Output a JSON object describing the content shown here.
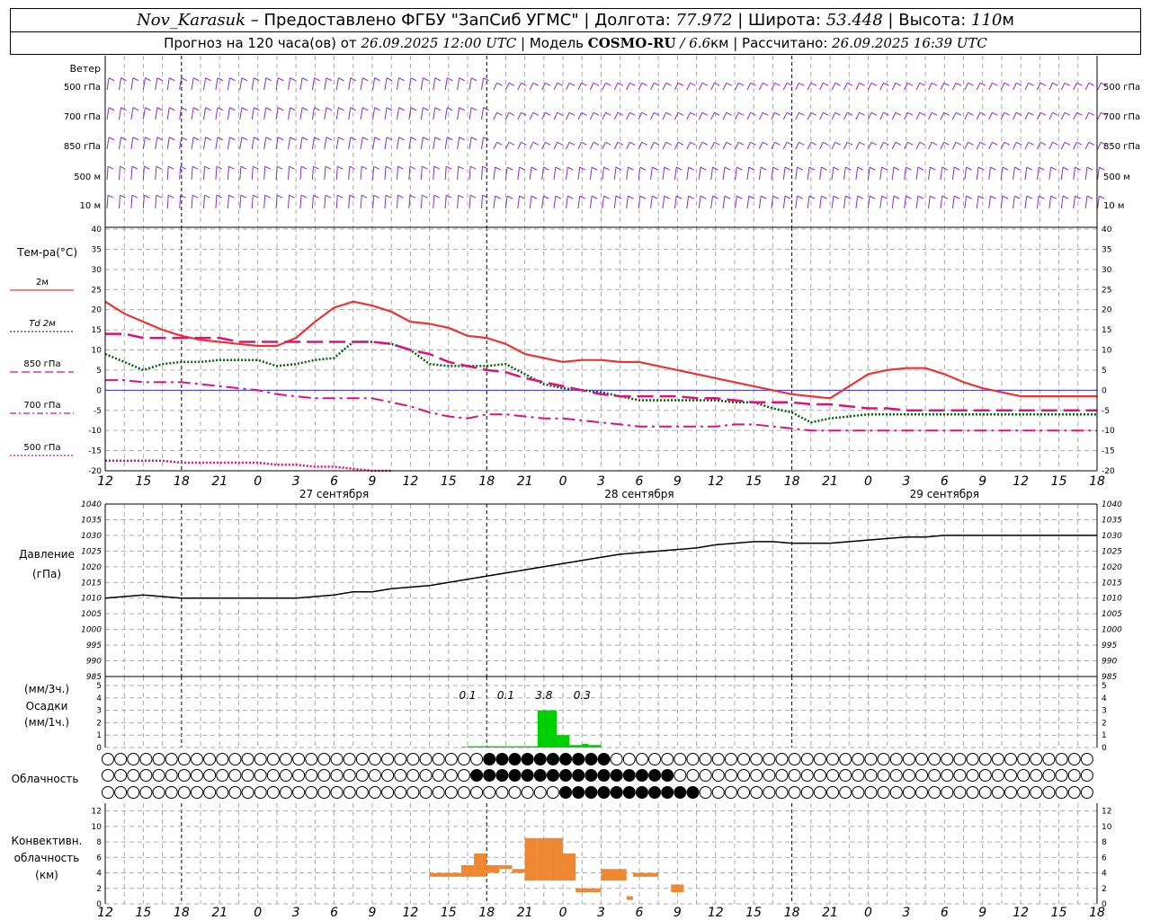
{
  "header": {
    "station": "Nov_Karasuk",
    "dash": " – ",
    "provider": "Предоставлено ФГБУ \"ЗапСиб УГМС\"",
    "sep": " | ",
    "lon_label": "Долгота: ",
    "lon_value": "77.972",
    "lat_label": "Широта: ",
    "lat_value": "53.448",
    "alt_label": "Высота: ",
    "alt_value": "110",
    "alt_unit": "м",
    "forecast_prefix": "Прогноз на 120 часа(ов) от ",
    "forecast_date": "26.09.2025 12:00 UTC",
    "model_label": " | Модель ",
    "model_name": "COSMO-RU",
    "model_res": " / 6.6",
    "model_res_unit": "км",
    "calc_label": " | Рассчитано: ",
    "calc_date": "26.09.2025 16:39 UTC"
  },
  "wind_panel": {
    "title": "Ветер",
    "levels": [
      "500 гПа",
      "700 гПа",
      "850 гПа",
      "500 м",
      "10 м"
    ],
    "color": "#8a2be2"
  },
  "time_axis": {
    "hour_labels": [
      "12",
      "15",
      "18",
      "21",
      "0",
      "3",
      "6",
      "9",
      "12",
      "15",
      "18",
      "21",
      "0",
      "3",
      "6",
      "9",
      "12",
      "15",
      "18",
      "21",
      "0",
      "3",
      "6",
      "9",
      "12",
      "15",
      "18"
    ],
    "date_labels": [
      "27 сентября",
      "28 сентября",
      "29 сентября"
    ]
  },
  "chart_data": [
    {
      "type": "line",
      "panel": "temperature",
      "title": "Тем-ра(°С)",
      "x_unit": "hours from 26.09.2025 12:00 UTC",
      "ylim": [
        -20,
        40
      ],
      "y_ticks": [
        40,
        35,
        30,
        25,
        20,
        15,
        10,
        5,
        0,
        -5,
        -10,
        -15,
        -20
      ],
      "grid": true,
      "legend": [
        {
          "name": "2м",
          "color": "#ee3333",
          "style": "solid"
        },
        {
          "name": "Td 2м",
          "color": "#006400",
          "style": "dotted"
        },
        {
          "name": "850 гПа",
          "color": "#e0127a",
          "style": "dashed"
        },
        {
          "name": "700 гПа",
          "color": "#e0127a",
          "style": "dashdot"
        },
        {
          "name": "500 гПа",
          "color": "#e0127a",
          "style": "dotted"
        }
      ],
      "series": [
        {
          "name": "2м",
          "x": [
            0,
            3,
            6,
            9,
            12,
            15,
            18,
            21,
            24,
            27,
            30,
            33,
            36,
            39,
            42,
            45,
            48,
            51,
            54,
            57,
            60,
            63,
            66,
            69,
            72,
            75,
            78,
            81,
            84,
            87,
            90,
            93,
            96,
            99,
            102,
            105,
            108,
            111,
            114,
            117,
            120,
            123,
            126,
            129,
            132,
            135,
            138,
            141,
            144,
            147,
            150,
            153,
            156
          ],
          "y": [
            22,
            19,
            17,
            15,
            13.5,
            12.5,
            12,
            11.5,
            11,
            11,
            13,
            17,
            20.5,
            22,
            21,
            19.5,
            17,
            16.5,
            15.5,
            13.5,
            13,
            11.5,
            9,
            8,
            7,
            7.5,
            7.5,
            7,
            7,
            6,
            5,
            4,
            3,
            2,
            1,
            0,
            -1,
            -1.5,
            -2,
            1,
            4,
            5,
            5.5,
            5.5,
            4,
            2,
            0.5,
            -0.5,
            -1.5,
            -1.5,
            -1.5,
            -1.5,
            -1.5
          ]
        },
        {
          "name": "Td 2м",
          "x": [
            0,
            3,
            6,
            9,
            12,
            15,
            18,
            21,
            24,
            27,
            30,
            33,
            36,
            39,
            42,
            45,
            48,
            51,
            54,
            57,
            60,
            63,
            66,
            69,
            72,
            75,
            78,
            81,
            84,
            87,
            90,
            93,
            96,
            99,
            102,
            105,
            108,
            111,
            114,
            117,
            120,
            123,
            126,
            129,
            132,
            135,
            138,
            141,
            144,
            147,
            150,
            153,
            156
          ],
          "y": [
            9,
            7,
            5,
            6.5,
            7,
            7,
            7.5,
            7.5,
            7.5,
            6,
            6.5,
            7.5,
            8,
            12,
            12,
            11.5,
            10,
            6.5,
            6,
            6,
            6,
            6.5,
            4,
            1.5,
            0.5,
            0,
            -0.5,
            -1.5,
            -2.5,
            -2.5,
            -2.5,
            -2.5,
            -2.5,
            -3,
            -3,
            -4.5,
            -5.5,
            -8,
            -7,
            -6.5,
            -6,
            -6,
            -6,
            -6,
            -6,
            -6,
            -6,
            -6,
            -6,
            -6,
            -6,
            -6,
            -6
          ]
        },
        {
          "name": "850 гПа",
          "x": [
            0,
            3,
            6,
            9,
            12,
            15,
            18,
            21,
            24,
            27,
            30,
            33,
            36,
            39,
            42,
            45,
            48,
            51,
            54,
            57,
            60,
            63,
            66,
            69,
            72,
            75,
            78,
            81,
            84,
            87,
            90,
            93,
            96,
            99,
            102,
            105,
            108,
            111,
            114,
            117,
            120,
            123,
            126,
            129,
            132,
            135,
            138,
            141,
            144,
            147,
            150,
            153,
            156
          ],
          "y": [
            14,
            14,
            13,
            13,
            13,
            13,
            13,
            12,
            12,
            12,
            12,
            12,
            12,
            12,
            12,
            11.5,
            10,
            9,
            7,
            6,
            5,
            4.5,
            3,
            2,
            1,
            0,
            -1,
            -1.5,
            -1.5,
            -1.5,
            -1.5,
            -2,
            -2,
            -2.5,
            -3,
            -3,
            -3,
            -3.5,
            -3.5,
            -4,
            -4.5,
            -4.5,
            -5,
            -5,
            -5,
            -5,
            -5,
            -5,
            -5,
            -5,
            -5,
            -5,
            -5
          ]
        },
        {
          "name": "700 гПа",
          "x": [
            0,
            3,
            6,
            9,
            12,
            15,
            18,
            21,
            24,
            27,
            30,
            33,
            36,
            39,
            42,
            45,
            48,
            51,
            54,
            57,
            60,
            63,
            66,
            69,
            72,
            75,
            78,
            81,
            84,
            87,
            90,
            93,
            96,
            99,
            102,
            105,
            108,
            111,
            114,
            117,
            120,
            123,
            126,
            129,
            132,
            135,
            138,
            141,
            144,
            147,
            150,
            153,
            156
          ],
          "y": [
            2.5,
            2.5,
            2,
            2,
            2,
            1.5,
            1,
            0.5,
            0,
            -1,
            -1.5,
            -2,
            -2,
            -2,
            -2,
            -3,
            -4,
            -5.5,
            -6.5,
            -7,
            -6,
            -6,
            -6.5,
            -7,
            -7,
            -7.5,
            -8,
            -8.5,
            -9,
            -9,
            -9,
            -9,
            -9,
            -8.5,
            -8.5,
            -9,
            -9.5,
            -10,
            -10,
            -10,
            -10,
            -10,
            -10,
            -10,
            -10,
            -10,
            -10,
            -10,
            -10,
            -10,
            -10,
            -10,
            -10
          ]
        },
        {
          "name": "500 гПа",
          "x": [
            0,
            3,
            6,
            9,
            12,
            15,
            18,
            21,
            24,
            27,
            30,
            33,
            36,
            39,
            42,
            45
          ],
          "y": [
            -17.5,
            -17.5,
            -17.5,
            -17.5,
            -18,
            -18,
            -18,
            -18,
            -18,
            -18.5,
            -18.5,
            -19,
            -19,
            -19.5,
            -20,
            -20
          ]
        }
      ]
    },
    {
      "type": "line",
      "panel": "pressure",
      "title": "Давление",
      "subtitle": "(гПа)",
      "x_unit": "hours from 26.09.2025 12:00 UTC",
      "ylim": [
        985,
        1040
      ],
      "y_ticks": [
        1040,
        1035,
        1030,
        1025,
        1020,
        1015,
        1010,
        1005,
        1000,
        995,
        990,
        985
      ],
      "grid": true,
      "series": [
        {
          "name": "",
          "color": "#000000",
          "x": [
            0,
            3,
            6,
            9,
            12,
            15,
            18,
            21,
            24,
            27,
            30,
            33,
            36,
            39,
            42,
            45,
            48,
            51,
            54,
            57,
            60,
            63,
            66,
            69,
            72,
            75,
            78,
            81,
            84,
            87,
            90,
            93,
            96,
            99,
            102,
            105,
            108,
            111,
            114,
            117,
            120,
            123,
            126,
            129,
            132,
            135,
            138,
            141,
            144,
            147,
            150,
            153,
            156
          ],
          "y": [
            1010,
            1010.5,
            1011,
            1010.5,
            1010,
            1010,
            1010,
            1010,
            1010,
            1010,
            1010,
            1010.5,
            1011,
            1012,
            1012,
            1013,
            1013.5,
            1014,
            1015,
            1016,
            1017,
            1018,
            1019,
            1020,
            1021,
            1022,
            1023,
            1024,
            1024.5,
            1025,
            1025.5,
            1026,
            1027,
            1027.5,
            1028,
            1028,
            1027.5,
            1027.5,
            1027.5,
            1028,
            1028.5,
            1029,
            1029.5,
            1029.5,
            1030,
            1030,
            1030,
            1030,
            1030,
            1030,
            1030,
            1030,
            1030
          ]
        }
      ]
    },
    {
      "type": "bar",
      "panel": "precipitation",
      "title": "Осадки",
      "unit_3h": "(мм/3ч.)",
      "unit_1h": "(мм/1ч.)",
      "ylim": [
        0,
        5
      ],
      "y_ticks": [
        5,
        4,
        3,
        2,
        1,
        0
      ],
      "color": "#00d000",
      "x": [
        56,
        57,
        58,
        59,
        60,
        61,
        62,
        63,
        64,
        65,
        66,
        67,
        68,
        69,
        70,
        71,
        72,
        73,
        74,
        75,
        76,
        77
      ],
      "values": [
        0.05,
        0.1,
        0.1,
        0.1,
        0.1,
        0.1,
        0.1,
        0.1,
        0.1,
        0.1,
        0.1,
        0.1,
        3,
        3,
        3,
        1,
        1,
        0.2,
        0.2,
        0.3,
        0.2,
        0.2
      ],
      "annotations": [
        {
          "x": 57,
          "text": "0.1"
        },
        {
          "x": 63,
          "text": "0.1"
        },
        {
          "x": 69,
          "text": "3.8"
        },
        {
          "x": 75,
          "text": "0.3"
        }
      ]
    },
    {
      "type": "bar",
      "panel": "convective_clouds",
      "title": "Конвективн. облачность",
      "unit": "(км)",
      "ylim": [
        0,
        13
      ],
      "y_ticks": [
        12,
        10,
        8,
        6,
        4,
        2,
        0
      ],
      "color": "#ee8833",
      "bars": [
        {
          "x0": 51,
          "x1": 56,
          "base": 3.5,
          "top": 4
        },
        {
          "x0": 56,
          "x1": 58,
          "base": 3.5,
          "top": 5
        },
        {
          "x0": 58,
          "x1": 60,
          "base": 3.5,
          "top": 6.5
        },
        {
          "x0": 60,
          "x1": 62,
          "base": 4,
          "top": 5
        },
        {
          "x0": 62,
          "x1": 64,
          "base": 4.5,
          "top": 5
        },
        {
          "x0": 64,
          "x1": 66,
          "base": 4,
          "top": 4.5
        },
        {
          "x0": 66,
          "x1": 68,
          "base": 3,
          "top": 8.5
        },
        {
          "x0": 68,
          "x1": 70,
          "base": 3,
          "top": 8.5
        },
        {
          "x0": 70,
          "x1": 72,
          "base": 3,
          "top": 8.5
        },
        {
          "x0": 72,
          "x1": 74,
          "base": 3,
          "top": 6.5
        },
        {
          "x0": 74,
          "x1": 78,
          "base": 1.5,
          "top": 2
        },
        {
          "x0": 78,
          "x1": 82,
          "base": 3,
          "top": 4.5
        },
        {
          "x0": 82,
          "x1": 83,
          "base": 0.5,
          "top": 1
        },
        {
          "x0": 83,
          "x1": 87,
          "base": 3.5,
          "top": 4
        },
        {
          "x0": 89,
          "x1": 91,
          "base": 1.5,
          "top": 2.5
        }
      ]
    }
  ],
  "cloudiness": {
    "title": "Облачность",
    "rows": 3,
    "columns": 78
  },
  "units": {
    "precip_3h": "(мм/3ч.)",
    "precip_1h": "(мм/1ч.)"
  }
}
